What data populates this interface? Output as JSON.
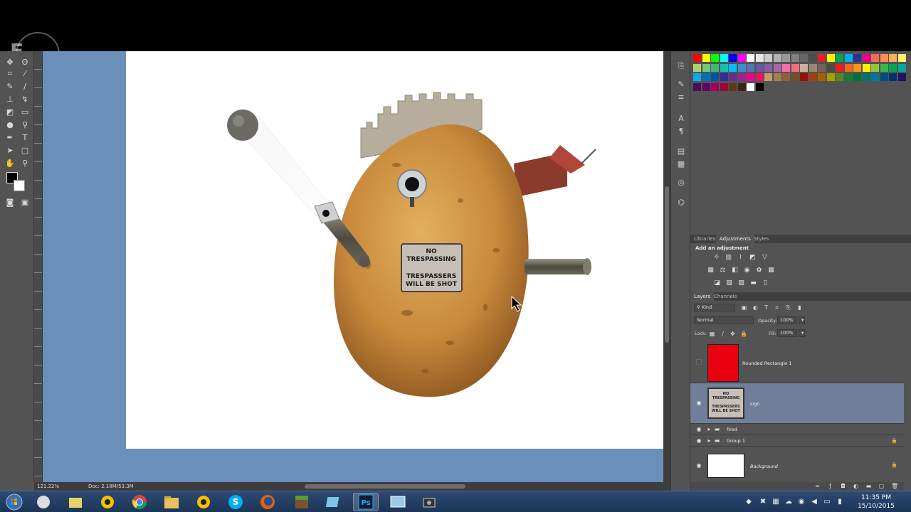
{
  "logo": {
    "text": "F"
  },
  "status": {
    "zoom": "121.22%",
    "doc": "Doc: 2.18M/53.3M"
  },
  "artwork": {
    "sign_line1": "NO",
    "sign_line2": "TRESPASSING",
    "sign_line3": "TRESPASSERS",
    "sign_line4": "WILL BE SHOT"
  },
  "panels": {
    "tabs_top": [
      "Libraries",
      "Adjustments",
      "Styles"
    ],
    "adjustments_title": "Add an adjustment",
    "tabs_layers": [
      "Layers",
      "Channels"
    ],
    "kind_label": "Kind",
    "blend_mode": "Normal",
    "opacity_label": "Opacity:",
    "opacity_value": "100%",
    "lock_label": "Lock:",
    "fill_label": "Fill:",
    "fill_value": "100%"
  },
  "layers": [
    {
      "name": "Rounded Rectangle 1",
      "visible": false,
      "selected": false,
      "thumb_color": "#e8000e"
    },
    {
      "name": "sign",
      "visible": true,
      "selected": true
    },
    {
      "name": "fired",
      "visible": true,
      "selected": false,
      "type": "group"
    },
    {
      "name": "Group 1",
      "visible": true,
      "selected": false,
      "type": "group",
      "locked": true
    },
    {
      "name": "Background",
      "visible": true,
      "selected": false,
      "locked": true,
      "thumb_color": "#ffffff"
    }
  ],
  "clock": {
    "time": "11:35 PM",
    "date": "15/10/2015"
  },
  "colors": {
    "canvas_bg": "#6a8fb9",
    "panel": "#535353",
    "selected_layer": "#6f7f9a"
  }
}
